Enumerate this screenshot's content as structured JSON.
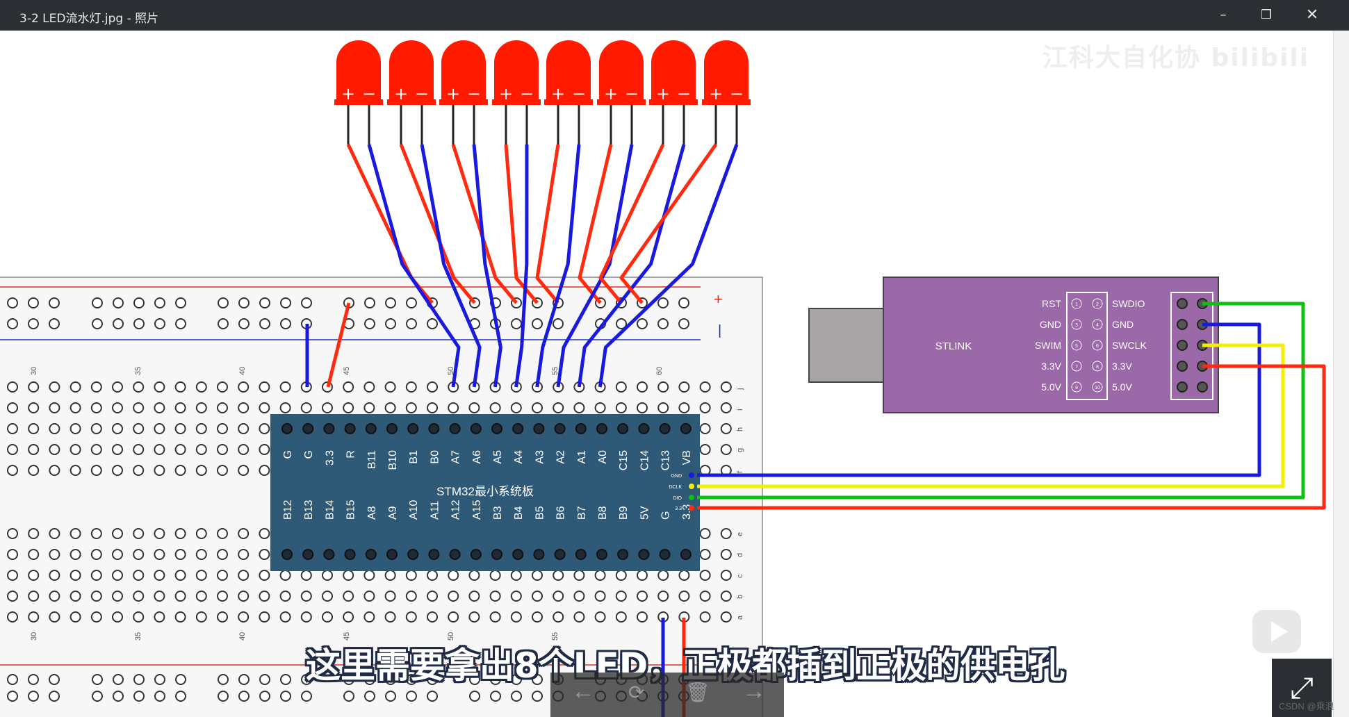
{
  "window": {
    "title": "3-2 LED流水灯.jpg - 照片",
    "minimize_icon": "minimize-icon",
    "restore_icon": "restore-icon",
    "close_icon": "close-icon"
  },
  "circuit": {
    "led_count": 8,
    "led_plus": "+",
    "led_minus": "−",
    "rail_plus": "+",
    "rail_minus": "|",
    "column_numbers_top": [
      "30",
      "35",
      "40",
      "45",
      "50",
      "55",
      "60"
    ],
    "column_numbers_bottom": [
      "30",
      "35",
      "40",
      "45",
      "50",
      "55"
    ],
    "row_letters_top": [
      "j",
      "i",
      "h",
      "g",
      "f"
    ],
    "row_letters_bottom": [
      "e",
      "d",
      "c",
      "b",
      "a"
    ],
    "board_title": "STM32最小系统板",
    "board_top_pins": [
      "G",
      "G",
      "3.3",
      "R",
      "B11",
      "B10",
      "B1",
      "B0",
      "A7",
      "A6",
      "A5",
      "A4",
      "A3",
      "A2",
      "A1",
      "A0",
      "C15",
      "C14",
      "C13",
      "VB"
    ],
    "board_bottom_pins": [
      "B12",
      "B13",
      "B14",
      "B15",
      "A8",
      "A9",
      "A10",
      "A11",
      "A12",
      "A15",
      "B3",
      "B4",
      "B5",
      "B6",
      "B7",
      "B8",
      "B9",
      "5V",
      "G",
      "3.3"
    ],
    "board_side_pins": [
      "GND",
      "DCLK",
      "DIO",
      "3.3"
    ],
    "stlink_label": "STLINK",
    "stlink_left_labels": [
      "RST",
      "GND",
      "SWIM",
      "3.3V",
      "5.0V"
    ],
    "stlink_right_labels": [
      "SWDIO",
      "GND",
      "SWCLK",
      "3.3V",
      "5.0V"
    ],
    "stlink_left_numbers": [
      "1",
      "3",
      "5",
      "7",
      "9"
    ],
    "stlink_right_numbers": [
      "2",
      "4",
      "6",
      "8",
      "10"
    ],
    "colors": {
      "led": "#ff1a00",
      "wire_red": "#ff2a10",
      "wire_blue": "#1a1adf",
      "wire_green": "#10c010",
      "wire_yellow": "#f0f000",
      "board": "#2e5a78",
      "stlink": "#9b69a8",
      "usb": "#a8a3a5"
    }
  },
  "overlay": {
    "subtitle": "这里需要拿出8个LED，正极都插到正极的供电孔",
    "watermark": "CSDN @乘浪",
    "play_icon": "play-icon",
    "fullscreen_icon": "fullscreen-icon",
    "toolbar_icons": [
      "back-arrow-icon",
      "rotate-icon",
      "delete-icon",
      "forward-arrow-icon"
    ]
  }
}
